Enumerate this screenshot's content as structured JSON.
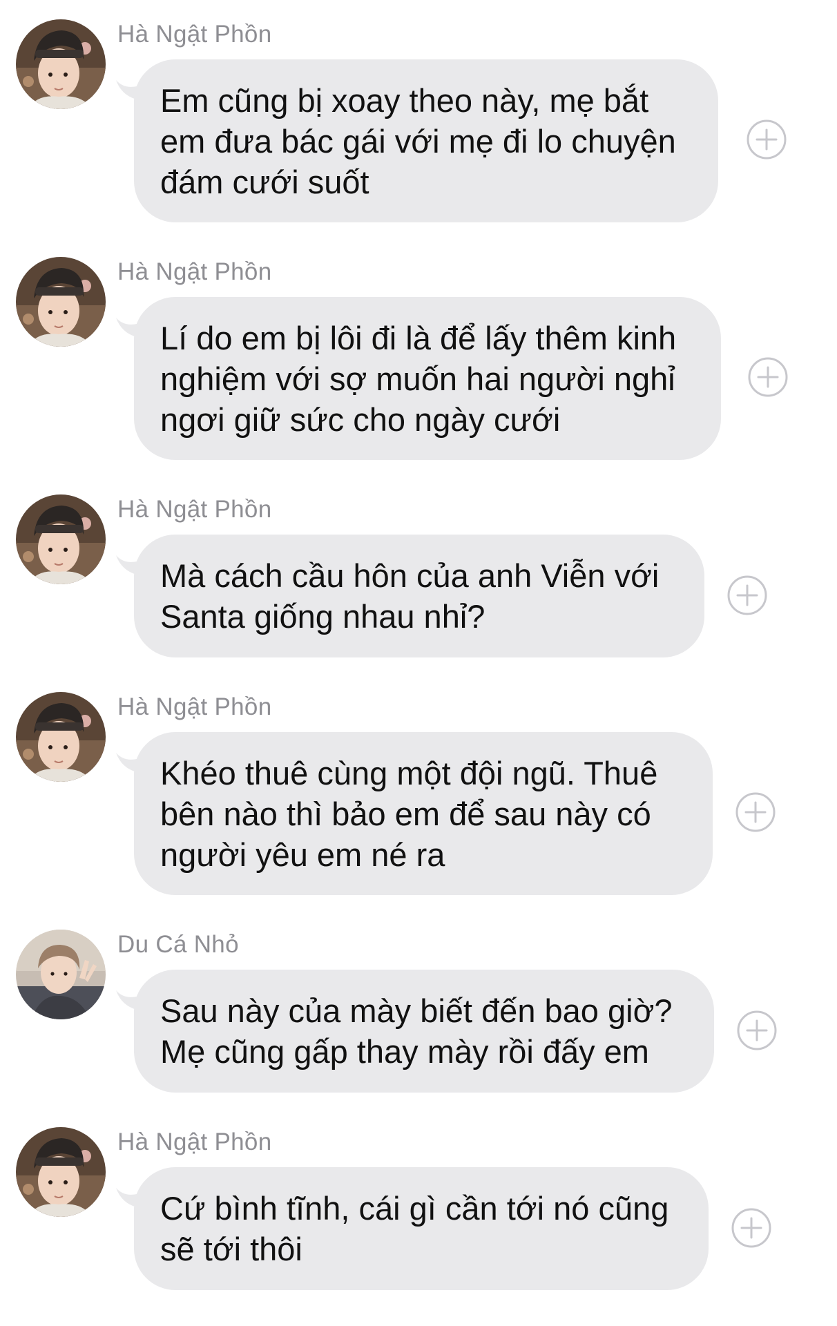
{
  "conversation": {
    "messages": [
      {
        "sender": "Hà Ngật Phồn",
        "avatar": "ha-ngat-phon-avatar",
        "lines": [
          "Em cũng bị xoay theo này, mẹ bắt",
          "em đưa bác gái với mẹ đi lo chuyện",
          "đám cưới suốt"
        ],
        "add_icon": "plus-circle-icon"
      },
      {
        "sender": "Hà Ngật Phồn",
        "avatar": "ha-ngat-phon-avatar",
        "lines": [
          "Lí do em bị lôi đi là để lấy thêm kinh",
          "nghiệm với sợ muốn hai người nghỉ",
          "ngơi giữ sức cho ngày cưới"
        ],
        "add_icon": "plus-circle-icon"
      },
      {
        "sender": "Hà Ngật Phồn",
        "avatar": "ha-ngat-phon-avatar",
        "lines": [
          "Mà cách cầu hôn của anh Viễn với",
          "Santa giống nhau nhỉ?"
        ],
        "add_icon": "plus-circle-icon"
      },
      {
        "sender": "Hà Ngật Phồn",
        "avatar": "ha-ngat-phon-avatar",
        "lines": [
          "Khéo thuê cùng một đội ngũ. Thuê",
          "bên nào thì bảo em để sau này có",
          "người yêu em né ra"
        ],
        "add_icon": "plus-circle-icon"
      },
      {
        "sender": "Du Cá Nhỏ",
        "avatar": "du-ca-nho-avatar",
        "lines": [
          "Sau này của mày biết đến bao giờ?",
          "Mẹ cũng gấp thay mày rồi đấy em"
        ],
        "add_icon": "plus-circle-icon"
      },
      {
        "sender": "Hà Ngật Phồn",
        "avatar": "ha-ngat-phon-avatar",
        "lines": [
          "Cứ bình tĩnh, cái gì cần tới nó cũng",
          "sẽ tới thôi"
        ],
        "add_icon": "plus-circle-icon"
      }
    ]
  },
  "colors": {
    "background": "#ffffff",
    "bubble": "#e9e9eb",
    "sender_name": "#8e8e93",
    "message_text": "#111111",
    "icon_stroke": "#c7c7cc"
  }
}
